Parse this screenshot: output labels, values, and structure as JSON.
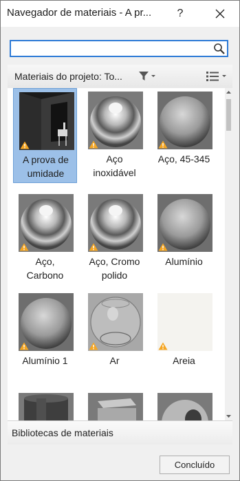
{
  "window": {
    "title": "Navegador de materiais - A pr...",
    "help_label": "?"
  },
  "search": {
    "value": "",
    "placeholder": ""
  },
  "filter": {
    "label": "Materiais do projeto: To..."
  },
  "materials": [
    {
      "line1": "A prova de",
      "line2": "umidade",
      "thumb": "room",
      "selected": true
    },
    {
      "line1": "Aço",
      "line2": "inoxidável",
      "thumb": "chrome"
    },
    {
      "line1": "Aço, 45-345",
      "line2": "",
      "thumb": "satin"
    },
    {
      "line1": "Aço,",
      "line2": "Carbono",
      "thumb": "chrome"
    },
    {
      "line1": "Aço, Cromo",
      "line2": "polido",
      "thumb": "chrome"
    },
    {
      "line1": "Alumínio",
      "line2": "",
      "thumb": "satin"
    },
    {
      "line1": "Alumínio 1",
      "line2": "",
      "thumb": "satin"
    },
    {
      "line1": "Ar",
      "line2": "",
      "thumb": "glass"
    },
    {
      "line1": "Areia",
      "line2": "",
      "thumb": "plain"
    },
    {
      "line1": "",
      "line2": "",
      "thumb": "cylinder"
    },
    {
      "line1": "",
      "line2": "",
      "thumb": "cube"
    },
    {
      "line1": "",
      "line2": "",
      "thumb": "torus"
    }
  ],
  "libraries": {
    "label": "Bibliotecas de materiais"
  },
  "actions": {
    "done_label": "Concluído"
  },
  "colors": {
    "selection": "#9cc0e8",
    "focus_border": "#2b79d6",
    "warning": "#f5a623"
  }
}
